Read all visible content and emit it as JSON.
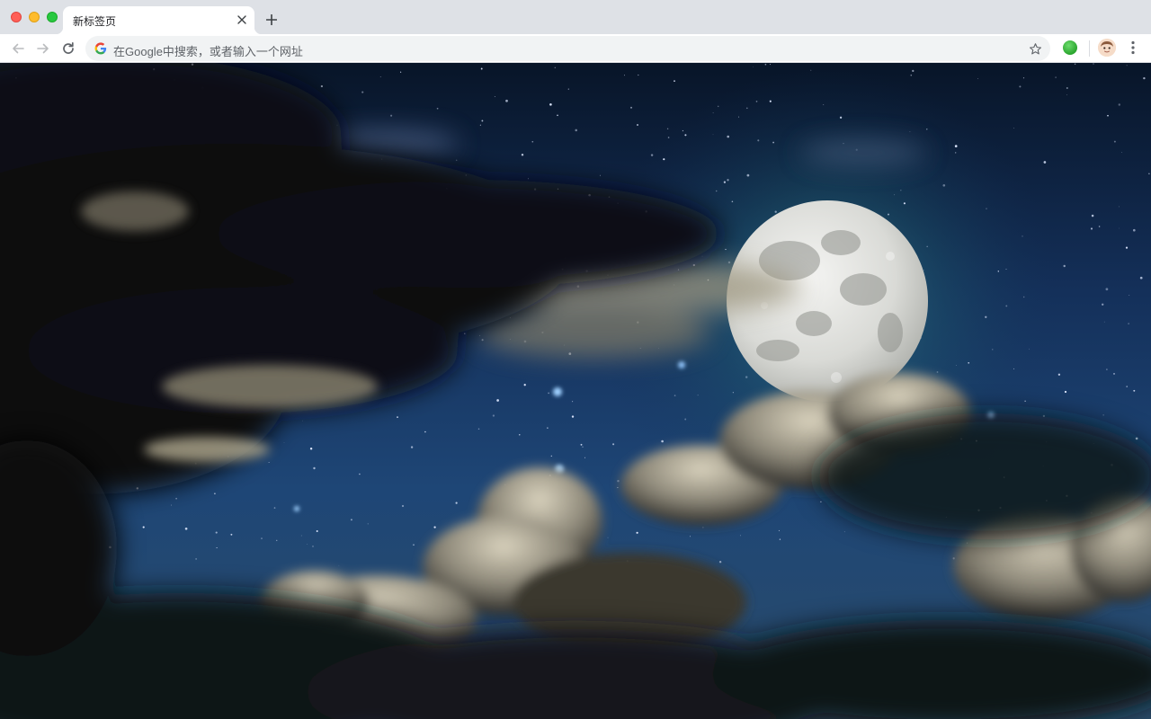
{
  "window": {
    "controls": [
      "close",
      "minimize",
      "maximize"
    ]
  },
  "tabs": [
    {
      "title": "新标签页",
      "active": true
    }
  ],
  "toolbar": {
    "back_icon": "arrow-left-icon",
    "forward_icon": "arrow-right-icon",
    "reload_icon": "reload-icon",
    "omnibox_placeholder": "在Google中搜索，或者输入一个网址",
    "bookmark_icon": "star-icon",
    "extension_icon": "green-circle-extension-icon",
    "profile_icon": "avatar-icon",
    "menu_icon": "more-vert-icon"
  },
  "wallpaper": {
    "subject": "full moon night sky with clouds",
    "colors": {
      "sky_top": "#0a1a33",
      "sky_mid": "#1d3d6b",
      "moon": "#e8e8e6"
    }
  }
}
